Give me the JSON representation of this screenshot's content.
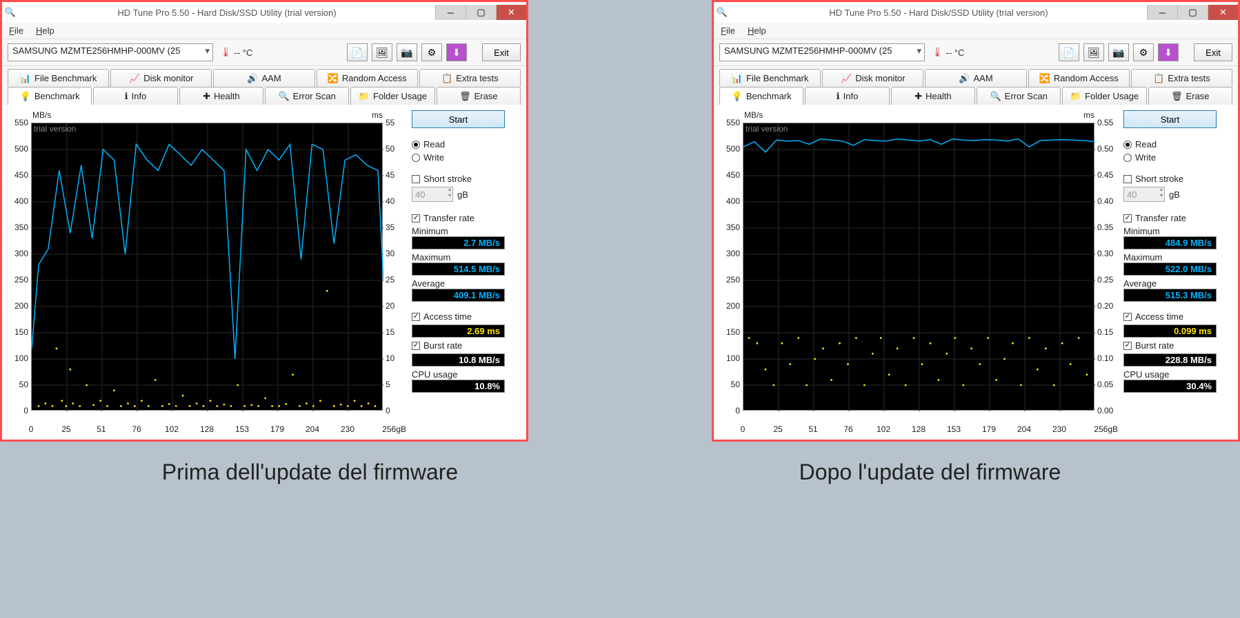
{
  "captions": {
    "left": "Prima dell'update del firmware",
    "right": "Dopo l'update del firmware"
  },
  "common": {
    "title": "HD Tune Pro 5.50 - Hard Disk/SSD Utility (trial version)",
    "menu": {
      "file": "File",
      "help": "Help"
    },
    "drive": "SAMSUNG MZMTE256HMHP-000MV (25",
    "temp_label": "-- °C",
    "exit": "Exit",
    "tabs_top": [
      "File Benchmark",
      "Disk monitor",
      "AAM",
      "Random Access",
      "Extra tests"
    ],
    "tabs_bot": [
      "Benchmark",
      "Info",
      "Health",
      "Error Scan",
      "Folder Usage",
      "Erase"
    ],
    "labels": {
      "mb_s": "MB/s",
      "ms": "ms",
      "start": "Start",
      "read": "Read",
      "write": "Write",
      "short_stroke": "Short stroke",
      "stroke_val": "40",
      "gB": "gB",
      "transfer": "Transfer rate",
      "min": "Minimum",
      "max": "Maximum",
      "avg": "Average",
      "access": "Access time",
      "burst": "Burst rate",
      "cpu": "CPU usage",
      "xunit": "256gB",
      "trial": "trial version"
    },
    "yticks_left": [
      "550",
      "500",
      "450",
      "400",
      "350",
      "300",
      "250",
      "200",
      "150",
      "100",
      "50",
      "0"
    ],
    "xticks": [
      "0",
      "25",
      "51",
      "76",
      "102",
      "128",
      "153",
      "179",
      "204",
      "230"
    ]
  },
  "left": {
    "yticks_right": [
      "55",
      "50",
      "45",
      "40",
      "35",
      "30",
      "25",
      "20",
      "15",
      "10",
      "5",
      "0"
    ],
    "metrics": {
      "min": "2.7 MB/s",
      "max": "514.5 MB/s",
      "avg": "409.1 MB/s",
      "access": "2.69 ms",
      "burst": "10.8 MB/s",
      "cpu": "10.8%"
    }
  },
  "right": {
    "yticks_right": [
      "0.55",
      "0.50",
      "0.45",
      "0.40",
      "0.35",
      "0.30",
      "0.25",
      "0.20",
      "0.15",
      "0.10",
      "0.05",
      "0.00"
    ],
    "metrics": {
      "min": "484.9 MB/s",
      "max": "522.0 MB/s",
      "avg": "515.3 MB/s",
      "access": "0.099 ms",
      "burst": "228.8 MB/s",
      "cpu": "30.4%"
    }
  },
  "chart_data": [
    {
      "type": "line",
      "title": "Transfer rate (before firmware)",
      "xlabel": "gB",
      "ylabel": "MB/s",
      "ylim": [
        0,
        550
      ],
      "series": [
        {
          "name": "Transfer",
          "color": "#00b4ff",
          "x": [
            0,
            5,
            12,
            20,
            28,
            36,
            44,
            52,
            60,
            68,
            76,
            84,
            92,
            100,
            108,
            116,
            124,
            132,
            140,
            148,
            156,
            164,
            172,
            180,
            188,
            196,
            204,
            212,
            220,
            228,
            236,
            244,
            252,
            256
          ],
          "values": [
            120,
            280,
            310,
            460,
            340,
            470,
            330,
            500,
            480,
            300,
            510,
            480,
            460,
            510,
            490,
            470,
            500,
            480,
            460,
            100,
            500,
            460,
            500,
            480,
            510,
            290,
            510,
            500,
            320,
            480,
            490,
            470,
            460,
            250
          ]
        }
      ],
      "y2label": "ms",
      "y2lim": [
        0,
        55
      ],
      "scatter": {
        "name": "Access",
        "color": "#ffe600",
        "x": [
          5,
          10,
          15,
          18,
          22,
          25,
          28,
          30,
          35,
          40,
          45,
          50,
          55,
          60,
          65,
          70,
          75,
          80,
          85,
          90,
          95,
          100,
          105,
          110,
          115,
          120,
          125,
          130,
          135,
          140,
          145,
          150,
          155,
          160,
          165,
          170,
          175,
          180,
          185,
          190,
          195,
          200,
          205,
          210,
          215,
          220,
          225,
          230,
          235,
          240,
          245,
          250
        ],
        "values": [
          1,
          1.5,
          1,
          12,
          2,
          1,
          8,
          1.5,
          1,
          5,
          1.2,
          2,
          1,
          4,
          1,
          1.5,
          1,
          2,
          1,
          6,
          1,
          1.4,
          1,
          3,
          1,
          1.5,
          1,
          2,
          1,
          1.3,
          1,
          5,
          1,
          1.2,
          1,
          2.5,
          1,
          1,
          1.4,
          7,
          1,
          1.5,
          1,
          2,
          23,
          1,
          1.3,
          1,
          2,
          1,
          1.5,
          1
        ]
      }
    },
    {
      "type": "line",
      "title": "Transfer rate (after firmware)",
      "xlabel": "gB",
      "ylabel": "MB/s",
      "ylim": [
        0,
        550
      ],
      "series": [
        {
          "name": "Transfer",
          "color": "#00b4ff",
          "x": [
            0,
            8,
            16,
            24,
            32,
            40,
            48,
            56,
            64,
            72,
            80,
            88,
            96,
            104,
            112,
            120,
            128,
            136,
            144,
            152,
            160,
            168,
            176,
            184,
            192,
            200,
            208,
            216,
            224,
            232,
            240,
            248,
            256
          ],
          "values": [
            505,
            515,
            495,
            518,
            516,
            517,
            510,
            520,
            518,
            516,
            508,
            519,
            517,
            516,
            520,
            518,
            516,
            519,
            510,
            520,
            518,
            517,
            519,
            518,
            516,
            520,
            505,
            517,
            518,
            519,
            518,
            517,
            515
          ]
        }
      ],
      "y2label": "ms",
      "y2lim": [
        0,
        0.55
      ],
      "scatter": {
        "name": "Access",
        "color": "#ffe600",
        "x": [
          4,
          10,
          16,
          22,
          28,
          34,
          40,
          46,
          52,
          58,
          64,
          70,
          76,
          82,
          88,
          94,
          100,
          106,
          112,
          118,
          124,
          130,
          136,
          142,
          148,
          154,
          160,
          166,
          172,
          178,
          184,
          190,
          196,
          202,
          208,
          214,
          220,
          226,
          232,
          238,
          244,
          250
        ],
        "values": [
          0.14,
          0.13,
          0.08,
          0.05,
          0.13,
          0.09,
          0.14,
          0.05,
          0.1,
          0.12,
          0.06,
          0.13,
          0.09,
          0.14,
          0.05,
          0.11,
          0.14,
          0.07,
          0.12,
          0.05,
          0.14,
          0.09,
          0.13,
          0.06,
          0.11,
          0.14,
          0.05,
          0.12,
          0.09,
          0.14,
          0.06,
          0.1,
          0.13,
          0.05,
          0.14,
          0.08,
          0.12,
          0.05,
          0.13,
          0.09,
          0.14,
          0.07
        ]
      }
    }
  ]
}
